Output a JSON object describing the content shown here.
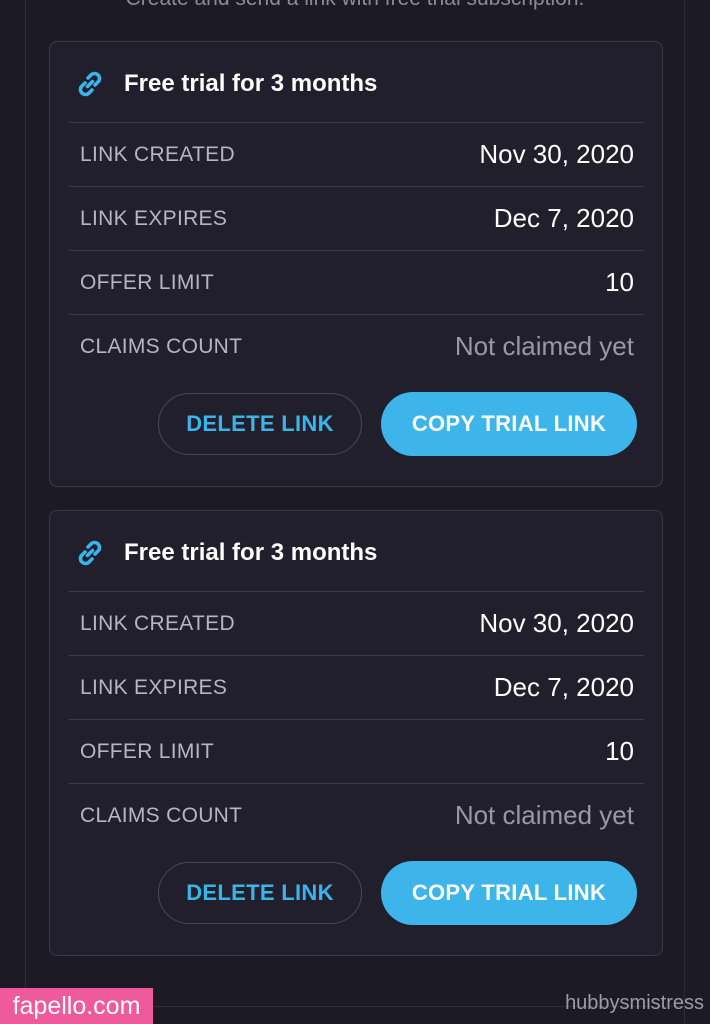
{
  "header": {
    "subtitle": "Create and send a link with free trial subscription."
  },
  "colors": {
    "background": "#1c1a24",
    "card": "#211f2b",
    "accent": "#3db4ea",
    "watermark": "#ee5a9c"
  },
  "cards": [
    {
      "icon": "link-icon",
      "title": "Free trial for 3 months",
      "rows": [
        {
          "label": "LINK CREATED",
          "value": "Nov 30, 2020"
        },
        {
          "label": "LINK EXPIRES",
          "value": "Dec 7, 2020"
        },
        {
          "label": "OFFER LIMIT",
          "value": "10"
        },
        {
          "label": "CLAIMS COUNT",
          "value": "Not claimed yet"
        }
      ],
      "delete_label": "DELETE LINK",
      "copy_label": "COPY TRIAL LINK"
    },
    {
      "icon": "link-icon",
      "title": "Free trial for 3 months",
      "rows": [
        {
          "label": "LINK CREATED",
          "value": "Nov 30, 2020"
        },
        {
          "label": "LINK EXPIRES",
          "value": "Dec 7, 2020"
        },
        {
          "label": "OFFER LIMIT",
          "value": "10"
        },
        {
          "label": "CLAIMS COUNT",
          "value": "Not claimed yet"
        }
      ],
      "delete_label": "DELETE LINK",
      "copy_label": "COPY TRIAL LINK"
    }
  ],
  "watermarks": {
    "site": "fapello.com",
    "user": "hubbysmistress"
  }
}
